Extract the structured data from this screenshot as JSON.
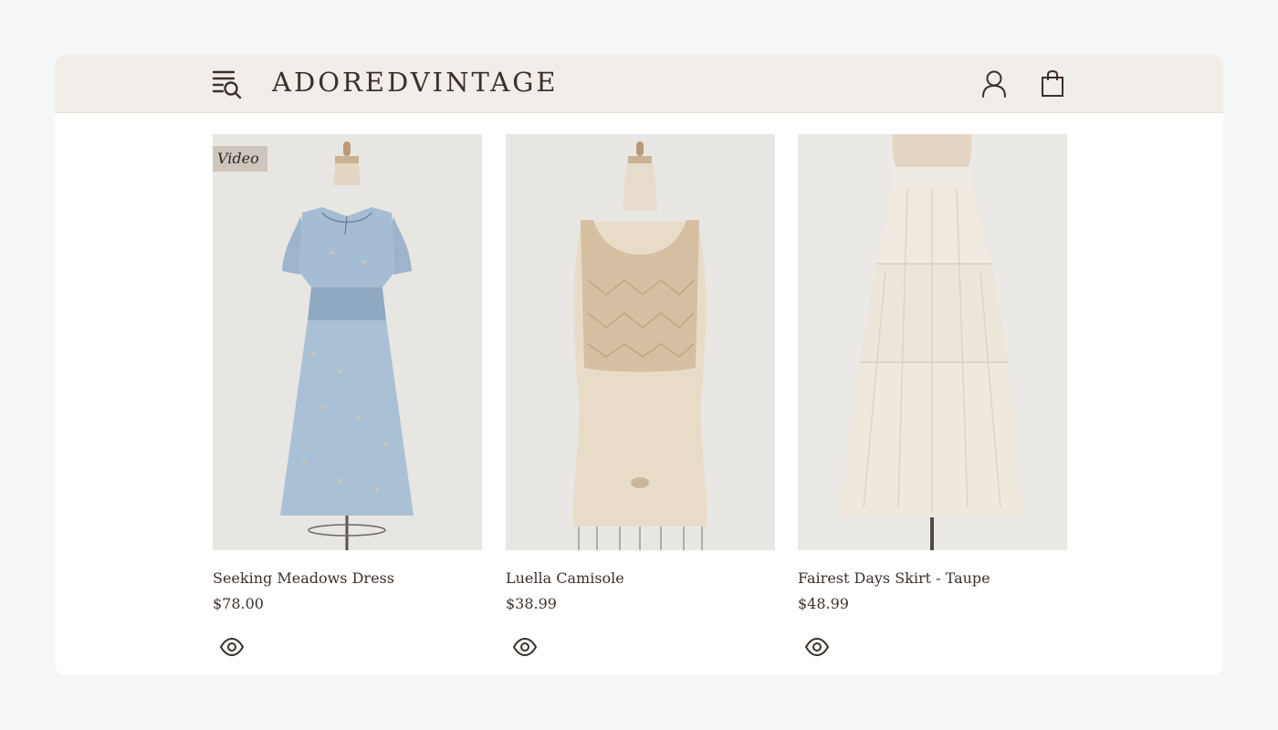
{
  "header": {
    "logo": "ADOREDVINTAGE",
    "menu_search_icon": "menu-search-icon",
    "account_icon": "user-icon",
    "cart_icon": "shopping-bag-icon"
  },
  "products": [
    {
      "title": "Seeking Meadows Dress",
      "price": "$78.00",
      "badge": "Video",
      "quick_view_icon": "eye-icon"
    },
    {
      "title": "Luella Camisole",
      "price": "$38.99",
      "badge": "",
      "quick_view_icon": "eye-icon"
    },
    {
      "title": "Fairest Days Skirt - Taupe",
      "price": "$48.99",
      "badge": "",
      "quick_view_icon": "eye-icon"
    }
  ],
  "colors": {
    "page_bg": "#f5f6f8",
    "header_bg": "#f1eeea",
    "text": "#3b302b",
    "badge_bg": "#cec6bd"
  }
}
